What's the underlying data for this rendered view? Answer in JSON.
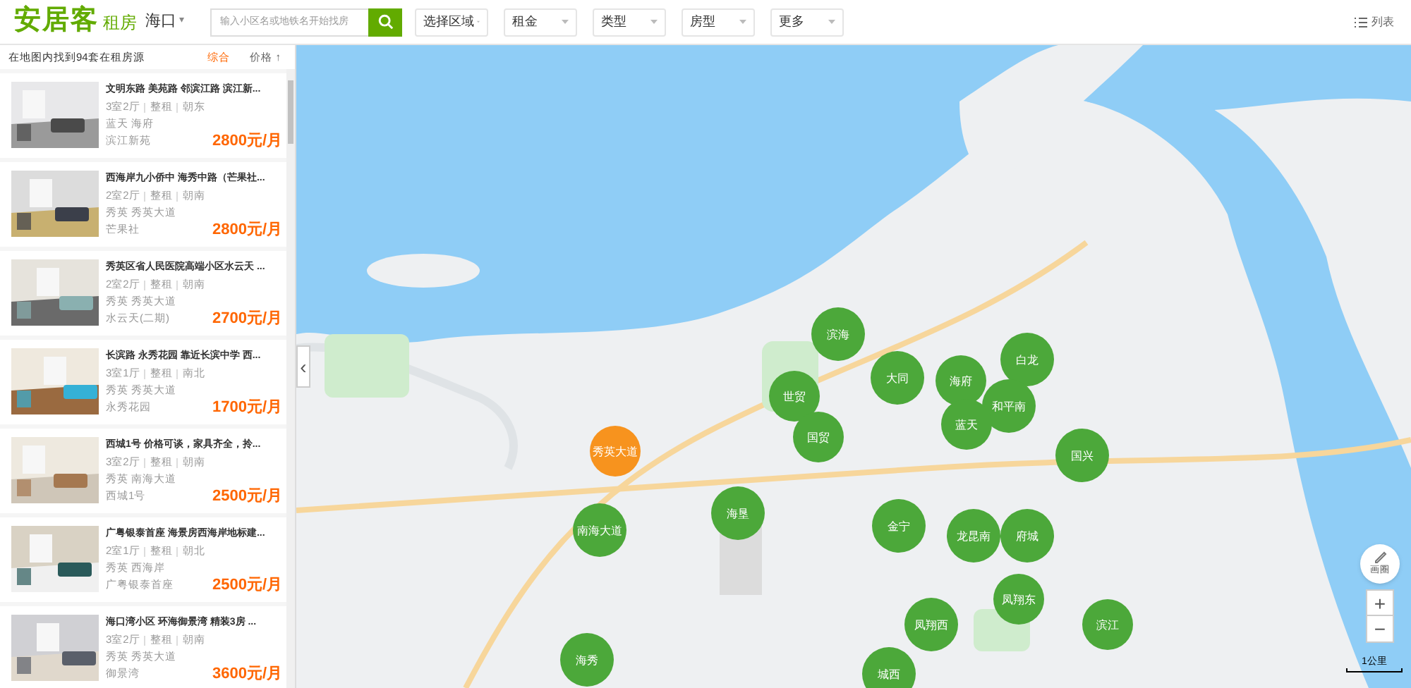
{
  "header": {
    "logo": "安居客",
    "channel": "租房",
    "city": "海口",
    "city_caret": "▾",
    "search": {
      "placeholder": "输入小区名或地铁名开始找房"
    },
    "filters": [
      {
        "label": "选择区域"
      },
      {
        "label": "租金"
      },
      {
        "label": "类型"
      },
      {
        "label": "房型"
      },
      {
        "label": "更多"
      }
    ],
    "view_toggle": "列表"
  },
  "list_panel": {
    "result_count": "在地图内找到94套在租房源",
    "sort": [
      {
        "label": "综合",
        "selected": true
      },
      {
        "label": "价格 ↑",
        "selected": false
      }
    ],
    "listings": [
      {
        "title": "文明东路 美苑路 邻滨江路 滨江新...",
        "layout": [
          "3室2厅",
          "整租",
          "朝东"
        ],
        "area": "蓝天 海府",
        "community": "滨江新苑",
        "price": "2800元/月"
      },
      {
        "title": "西海岸九小侨中 海秀中路（芒果社...",
        "layout": [
          "2室2厅",
          "整租",
          "朝南"
        ],
        "area": "秀英 秀英大道",
        "community": "芒果社",
        "price": "2800元/月"
      },
      {
        "title": "秀英区省人民医院高端小区水云天 ...",
        "layout": [
          "2室2厅",
          "整租",
          "朝南"
        ],
        "area": "秀英 秀英大道",
        "community": "水云天(二期)",
        "price": "2700元/月"
      },
      {
        "title": "长滨路 永秀花园 靠近长滨中学 西...",
        "layout": [
          "3室1厅",
          "整租",
          "南北"
        ],
        "area": "秀英 秀英大道",
        "community": "永秀花园",
        "price": "1700元/月"
      },
      {
        "title": "西城1号 价格可谈，家具齐全，拎...",
        "layout": [
          "3室2厅",
          "整租",
          "朝南"
        ],
        "area": "秀英 南海大道",
        "community": "西城1号",
        "price": "2500元/月"
      },
      {
        "title": "广粤银泰首座 海景房西海岸地标建...",
        "layout": [
          "2室1厅",
          "整租",
          "朝北"
        ],
        "area": "秀英 西海岸",
        "community": "广粤银泰首座",
        "price": "2500元/月"
      },
      {
        "title": "海口湾小区 环海御景湾 精装3房 ...",
        "layout": [
          "3室2厅",
          "整租",
          "朝南"
        ],
        "area": "秀英 秀英大道",
        "community": "御景湾",
        "price": "3600元/月"
      }
    ]
  },
  "map": {
    "collapse_handle": "‹",
    "districts": [
      {
        "name": "滨海",
        "selected": false
      },
      {
        "name": "大同",
        "selected": false
      },
      {
        "name": "海府",
        "selected": false
      },
      {
        "name": "白龙",
        "selected": false
      },
      {
        "name": "世贸",
        "selected": false
      },
      {
        "name": "和平南",
        "selected": false
      },
      {
        "name": "蓝天",
        "selected": false
      },
      {
        "name": "国贸",
        "selected": false
      },
      {
        "name": "秀英大道",
        "selected": true
      },
      {
        "name": "国兴",
        "selected": false
      },
      {
        "name": "海垦",
        "selected": false
      },
      {
        "name": "南海大道",
        "selected": false
      },
      {
        "name": "金宁",
        "selected": false
      },
      {
        "name": "龙昆南",
        "selected": false
      },
      {
        "name": "府城",
        "selected": false
      },
      {
        "name": "凤翔东",
        "selected": false
      },
      {
        "name": "凤翔西",
        "selected": false
      },
      {
        "name": "滨江",
        "selected": false
      },
      {
        "name": "海秀",
        "selected": false
      },
      {
        "name": "城西",
        "selected": false
      }
    ],
    "draw_tool": "画圈",
    "zoom_in": "+",
    "zoom_out": "−",
    "scale": "1公里"
  }
}
